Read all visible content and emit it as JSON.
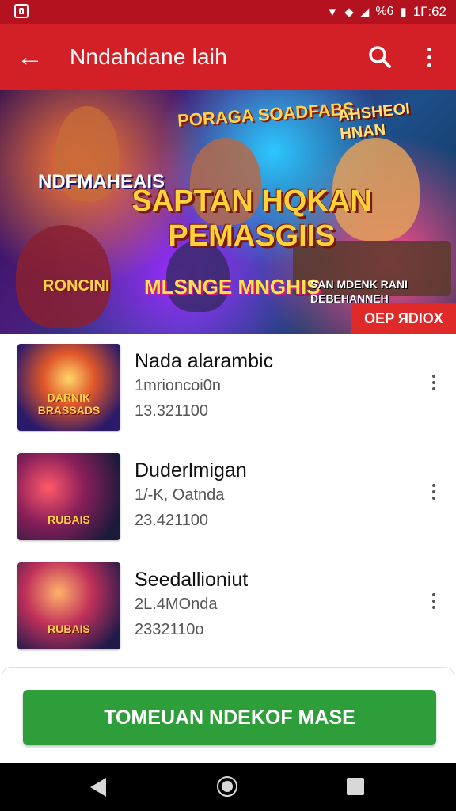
{
  "status_bar": {
    "battery_text": "%6",
    "time": "1Г:62"
  },
  "app_bar": {
    "title": "Nndahdane laih"
  },
  "banner": {
    "headline": "SAPTAN HQKAN PEMASGIIS",
    "subtitle_top_center": "PORAGA SOADFABS",
    "subtitle_top_right": "AHSHEOI HNAN",
    "subtitle_left": "NDFMAHEAIS",
    "subtitle_bottom_center": "MLSNGE MNGHIS",
    "subtitle_bottom_left": "RONCINI",
    "subtitle_bottom_right": "SAN MDENK RANI DEBEHANNEH",
    "badge": "OEP ЯDIOX"
  },
  "list": {
    "items": [
      {
        "name": "Nada alarambic",
        "meta": "1mrioncoi0n",
        "count": "13.321100",
        "thumb_text": "DARNIK BRASSADS"
      },
      {
        "name": "Duderlmigan",
        "meta": "1/-K, Oatnda",
        "count": "23.421100",
        "thumb_text": "RUBAIS"
      },
      {
        "name": "Seedallioniut",
        "meta": "2L.4MOnda",
        "count": "2332110o",
        "thumb_text": "RUBAIS"
      }
    ]
  },
  "cta": {
    "label": "TOMEUAN NDEKOF MASE"
  },
  "colors": {
    "app_bar": "#d32027",
    "status_bar": "#b3121e",
    "cta": "#2e9e3a",
    "badge": "#e02a2a"
  }
}
